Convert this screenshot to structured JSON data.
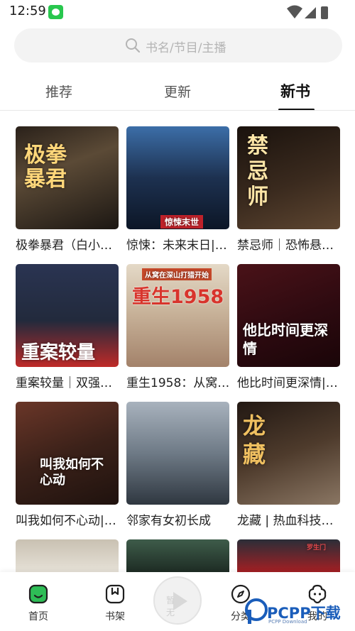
{
  "status": {
    "time": "12:59"
  },
  "search": {
    "placeholder": "书名/节目/主播"
  },
  "tabs": [
    {
      "label": "推荐",
      "active": false
    },
    {
      "label": "更新",
      "active": false
    },
    {
      "label": "新书",
      "active": true
    }
  ],
  "books": [
    {
      "title": "极拳暴君（白小…",
      "cover_text": "极拳暴君"
    },
    {
      "title": "惊悚：未来末日|…",
      "cover_text": "惊悚末世"
    },
    {
      "title": "禁忌师｜恐怖悬…",
      "cover_text": "禁忌师"
    },
    {
      "title": "重案较量｜双强…",
      "cover_text": "重案较量"
    },
    {
      "title": "重生1958：从窝…",
      "cover_text": "重生1958",
      "cover_subtext": "从窝在深山打猎开始"
    },
    {
      "title": "他比时间更深情|…",
      "cover_text": "他比时间更深情"
    },
    {
      "title": "叫我如何不心动|…",
      "cover_text": "叫我如何不心动"
    },
    {
      "title": "邻家有女初长成",
      "cover_text": ""
    },
    {
      "title": "龙藏 | 热血科技…",
      "cover_text": "龙藏"
    }
  ],
  "partial_covers": [
    {
      "cover_text": ""
    },
    {
      "cover_text": ""
    },
    {
      "cover_text": "罗生门"
    }
  ],
  "bottom_nav": {
    "home": "首页",
    "shelf": "书架",
    "play": "暂无",
    "category": "分类",
    "mine": "我的"
  },
  "watermark": {
    "text": "PCPP下载",
    "sub": "PCPP Download"
  },
  "colors": {
    "accent_green": "#2ebd56",
    "active_tab": "#111111"
  }
}
